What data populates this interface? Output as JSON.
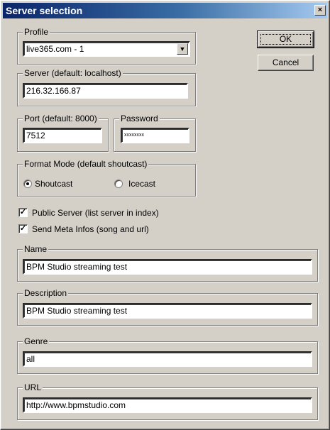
{
  "window": {
    "title": "Server selection",
    "close_glyph": "×"
  },
  "buttons": {
    "ok": "OK",
    "cancel": "Cancel"
  },
  "profile": {
    "legend": "Profile",
    "value": "live365.com - 1",
    "arrow": "▼"
  },
  "server": {
    "legend": "Server (default: localhost)",
    "value": "216.32.166.87"
  },
  "port": {
    "legend": "Port (default: 8000)",
    "value": "7512"
  },
  "password": {
    "legend": "Password",
    "value": "xxxxxxxx"
  },
  "format_mode": {
    "legend": "Format Mode (default shoutcast)",
    "options": [
      {
        "label": "Shoutcast",
        "checked": true
      },
      {
        "label": "Icecast",
        "checked": false
      }
    ]
  },
  "checkboxes": [
    {
      "label": "Public Server (list server in index)",
      "checked": true,
      "mark": "✓"
    },
    {
      "label": "Send Meta Infos (song and url)",
      "checked": true,
      "mark": "✓"
    }
  ],
  "name": {
    "legend": "Name",
    "value": "BPM Studio streaming test"
  },
  "description": {
    "legend": "Description",
    "value": "BPM Studio streaming test"
  },
  "genre": {
    "legend": "Genre",
    "value": "all"
  },
  "url": {
    "legend": "URL",
    "value": "http://www.bpmstudio.com"
  }
}
